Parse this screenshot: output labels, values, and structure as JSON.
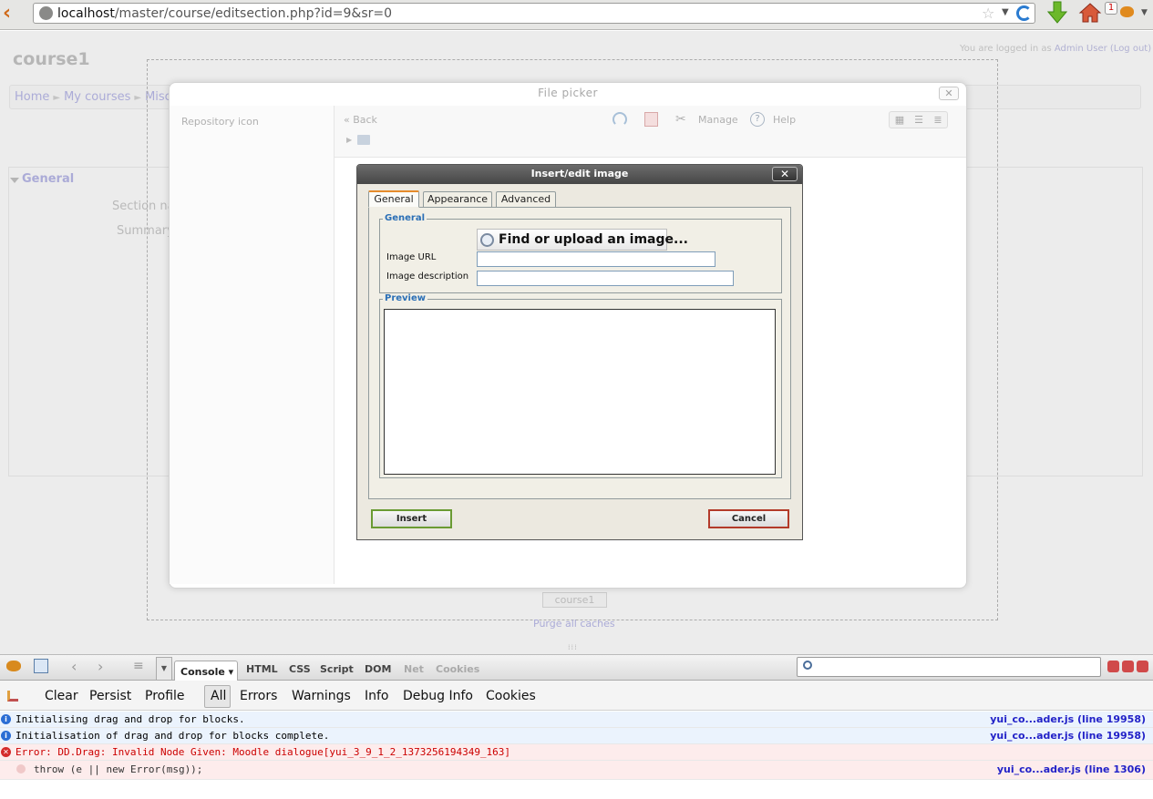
{
  "browser": {
    "url_host": "localhost",
    "url_path": "/master/course/editsection.php?id=9&sr=0",
    "notification_count": "1"
  },
  "page": {
    "login_prefix": "You are logged in as ",
    "login_user": "Admin User",
    "logout": "(Log out)",
    "course_title": "course1",
    "breadcrumb": [
      "Home",
      "My courses",
      "Misc"
    ],
    "section_legend": "General",
    "label_section_name": "Section na",
    "label_summary": "Summary",
    "course_button": "course1",
    "purge_caches": "Purge all caches"
  },
  "file_picker": {
    "title": "File picker",
    "repository_icon": "Repository icon",
    "back": "« Back",
    "manage": "Manage",
    "help": "Help"
  },
  "image_dialog": {
    "title": "Insert/edit image",
    "tabs": [
      "General",
      "Appearance",
      "Advanced"
    ],
    "general_legend": "General",
    "find_upload": "Find or upload an image...",
    "image_url_label": "Image URL",
    "image_url_value": "",
    "image_desc_label": "Image description",
    "image_desc_value": "",
    "preview_legend": "Preview",
    "insert": "Insert",
    "cancel": "Cancel"
  },
  "firebug": {
    "tabs": [
      "Console",
      "HTML",
      "CSS",
      "Script",
      "DOM",
      "Net",
      "Cookies"
    ],
    "commands": [
      "Clear",
      "Persist",
      "Profile"
    ],
    "filters": [
      "All",
      "Errors",
      "Warnings",
      "Info",
      "Debug Info",
      "Cookies"
    ],
    "logs": [
      {
        "type": "info",
        "message": "Initialising drag and drop for blocks.",
        "source": "yui_co...ader.js (line 19958)"
      },
      {
        "type": "info",
        "message": "Initialisation of drag and drop for blocks complete.",
        "source": "yui_co...ader.js (line 19958)"
      },
      {
        "type": "error",
        "message": "Error: DD.Drag: Invalid Node Given: Moodle dialogue[yui_3_9_1_2_1373256194349_163]",
        "source": ""
      },
      {
        "type": "trace",
        "message": "throw (e || new Error(msg));",
        "source": "yui_co...ader.js (line 1306)"
      }
    ]
  }
}
